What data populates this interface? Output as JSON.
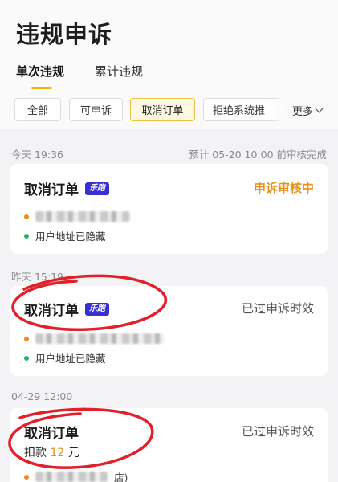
{
  "header": {
    "title": "违规申诉"
  },
  "tabs": [
    {
      "label": "单次违规",
      "active": true
    },
    {
      "label": "累计违规",
      "active": false
    }
  ],
  "filters": {
    "chips": [
      "全部",
      "可申诉",
      "取消订单",
      "拒绝系统推"
    ],
    "selected": "取消订单",
    "more_label": "更多"
  },
  "sections": [
    {
      "date": "今天 19:36",
      "note": "预计 05-20 10:00 前审核完成",
      "card": {
        "title": "取消订单",
        "badge": "乐跑",
        "status": "申诉审核中",
        "address_hidden": "用户地址已隐藏"
      }
    },
    {
      "date": "昨天 15:19",
      "note": "",
      "card": {
        "title": "取消订单",
        "badge": "乐跑",
        "status": "已过申诉时效",
        "address_hidden": "用户地址已隐藏"
      }
    },
    {
      "date": "04-29 12:00",
      "note": "",
      "card": {
        "title": "取消订单",
        "status": "已过申诉时效",
        "deduct_label": "扣款",
        "deduct_amount": "12",
        "deduct_unit": "元",
        "address_suffix": "店)"
      }
    }
  ],
  "colors": {
    "accent": "#f4b400",
    "pending": "#e5921a",
    "badge_bg": "#3a2fd0",
    "annotation_red": "#e0202a"
  }
}
